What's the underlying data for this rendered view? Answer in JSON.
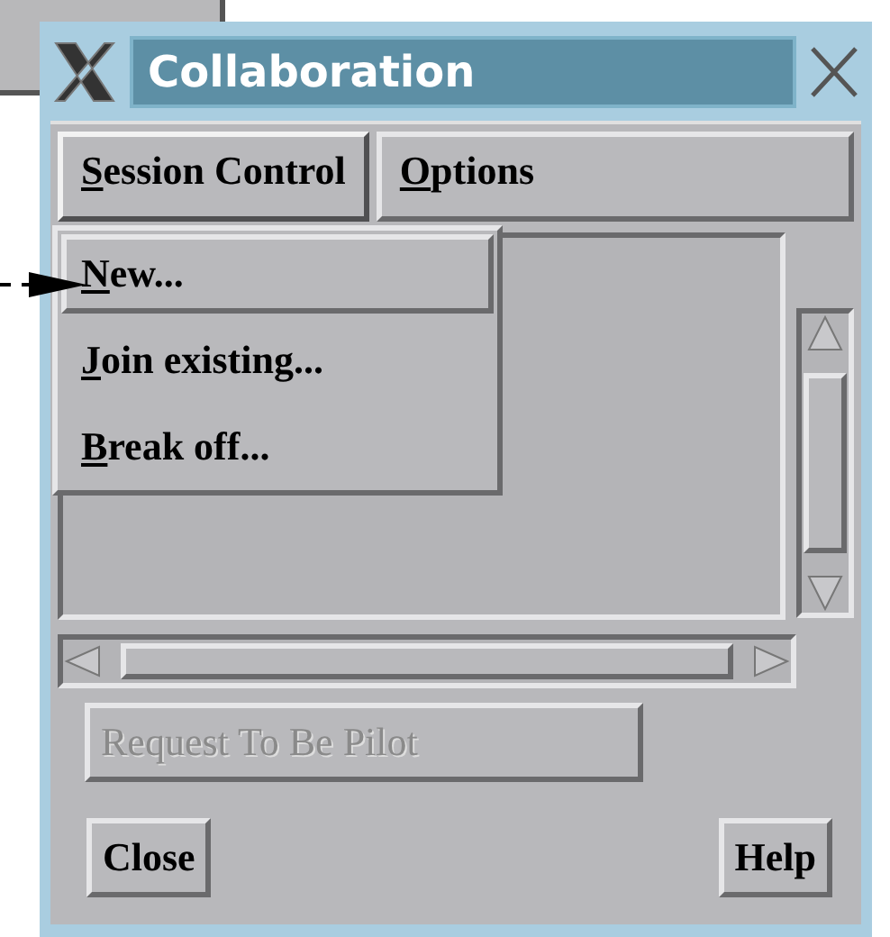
{
  "window": {
    "title": "Collaboration"
  },
  "menubar": [
    {
      "label": "Session Control",
      "selected": true
    },
    {
      "label": "Options",
      "selected": false
    }
  ],
  "menu": [
    {
      "label": "New...",
      "selected": true
    },
    {
      "label": "Join existing...",
      "selected": false
    },
    {
      "label": "Break off...",
      "selected": false
    }
  ],
  "buttons": [
    {
      "label": "Request To Be Pilot",
      "disabled": true,
      "kind": "wide"
    },
    {
      "label": "Close",
      "disabled": false,
      "kind": "left"
    },
    {
      "label": "Help",
      "disabled": false,
      "kind": "right"
    }
  ]
}
